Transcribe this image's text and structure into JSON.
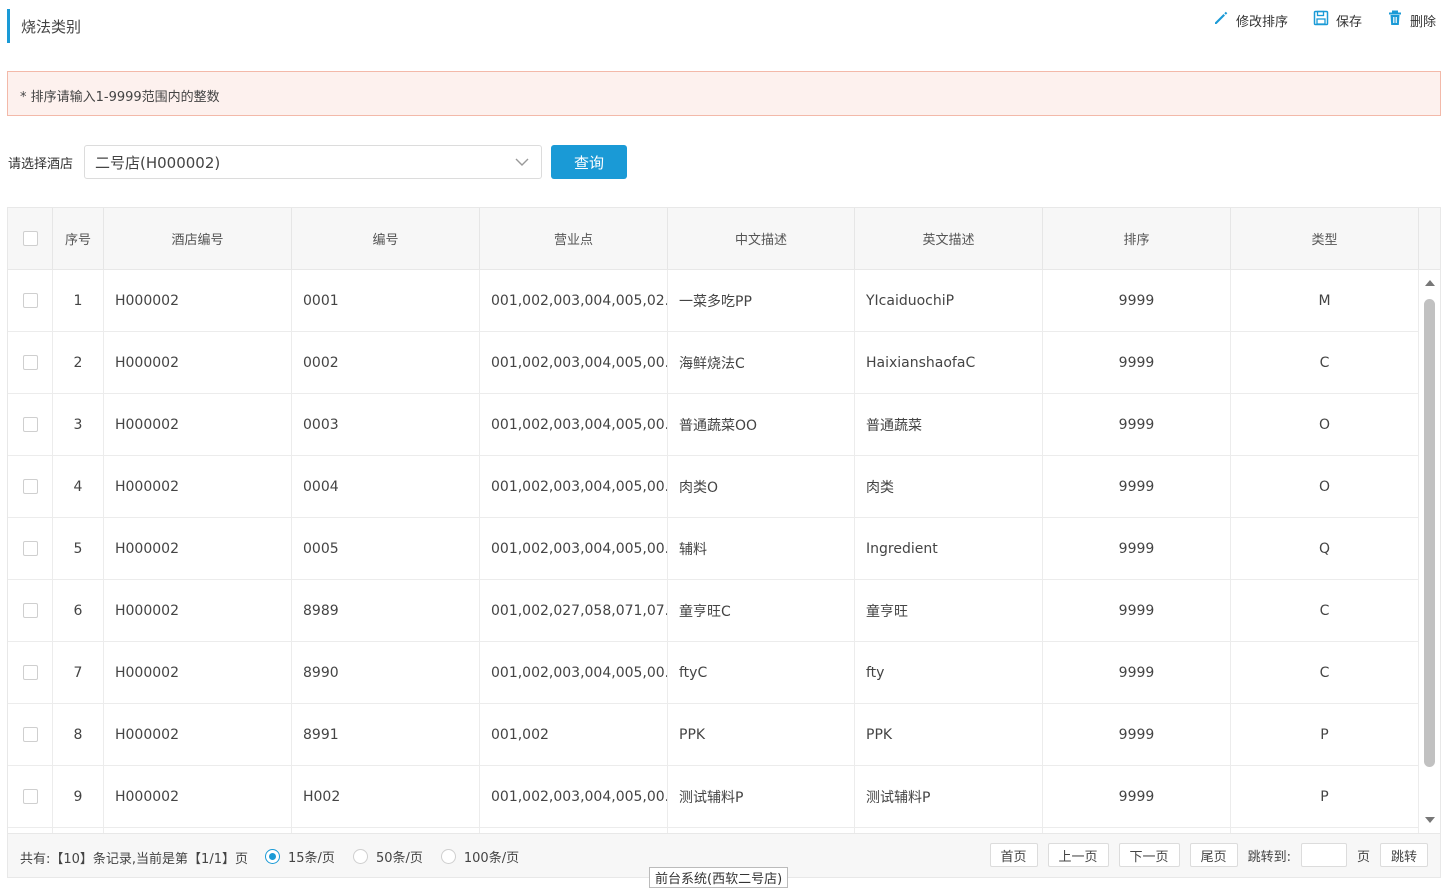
{
  "header": {
    "title": "烧法类别",
    "actions": [
      {
        "label": "修改排序",
        "icon": "pencil-icon"
      },
      {
        "label": "保存",
        "icon": "floppy-disk-icon"
      },
      {
        "label": "删除",
        "icon": "trash-icon"
      }
    ]
  },
  "notice": {
    "text": "* 排序请输入1-9999范围内的整数"
  },
  "filter": {
    "label": "请选择酒店",
    "selected": "二号店(H000002)",
    "query_label": "查询"
  },
  "table": {
    "columns": [
      "序号",
      "酒店编号",
      "编号",
      "营业点",
      "中文描述",
      "英文描述",
      "排序",
      "类型"
    ],
    "rows": [
      {
        "no": "1",
        "hotel": "H000002",
        "code": "0001",
        "outlets": "001,002,003,004,005,02...",
        "cn": "一菜多吃PP",
        "en": "YIcaiduochiP",
        "sort": "9999",
        "type": "M"
      },
      {
        "no": "2",
        "hotel": "H000002",
        "code": "0002",
        "outlets": "001,002,003,004,005,00...",
        "cn": "海鲜烧法C",
        "en": "HaixianshaofaC",
        "sort": "9999",
        "type": "C"
      },
      {
        "no": "3",
        "hotel": "H000002",
        "code": "0003",
        "outlets": "001,002,003,004,005,00...",
        "cn": "普通蔬菜OO",
        "en": "普通蔬菜",
        "sort": "9999",
        "type": "O"
      },
      {
        "no": "4",
        "hotel": "H000002",
        "code": "0004",
        "outlets": "001,002,003,004,005,00...",
        "cn": "肉类O",
        "en": "肉类",
        "sort": "9999",
        "type": "O"
      },
      {
        "no": "5",
        "hotel": "H000002",
        "code": "0005",
        "outlets": "001,002,003,004,005,00...",
        "cn": "辅料",
        "en": "Ingredient",
        "sort": "9999",
        "type": "Q"
      },
      {
        "no": "6",
        "hotel": "H000002",
        "code": "8989",
        "outlets": "001,002,027,058,071,07...",
        "cn": "童亨旺C",
        "en": "童亨旺",
        "sort": "9999",
        "type": "C"
      },
      {
        "no": "7",
        "hotel": "H000002",
        "code": "8990",
        "outlets": "001,002,003,004,005,00...",
        "cn": "ftyC",
        "en": "fty",
        "sort": "9999",
        "type": "C"
      },
      {
        "no": "8",
        "hotel": "H000002",
        "code": "8991",
        "outlets": "001,002",
        "cn": "PPK",
        "en": "PPK",
        "sort": "9999",
        "type": "P"
      },
      {
        "no": "9",
        "hotel": "H000002",
        "code": "H002",
        "outlets": "001,002,003,004,005,00...",
        "cn": "测试辅料P",
        "en": "测试辅料P",
        "sort": "9999",
        "type": "P"
      }
    ]
  },
  "footer": {
    "summary": "共有:【10】条记录,当前是第【1/1】页",
    "page_sizes": [
      {
        "label": "15条/页",
        "selected": true
      },
      {
        "label": "50条/页",
        "selected": false
      },
      {
        "label": "100条/页",
        "selected": false
      }
    ],
    "first": "首页",
    "prev": "上一页",
    "next": "下一页",
    "last": "尾页",
    "jump_label": "跳转到:",
    "page_unit": "页",
    "jump_button": "跳转"
  },
  "status_tip": "前台系统(西软二号店)",
  "colors": {
    "accent": "#1a9ad6",
    "notice_bg": "#fdf1ee",
    "notice_border": "#f3b9a9"
  }
}
